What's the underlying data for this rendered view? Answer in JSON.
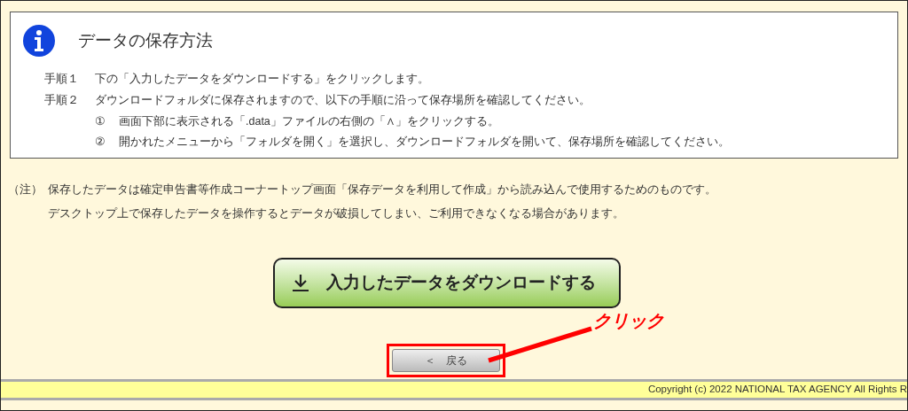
{
  "info_box": {
    "title": "データの保存方法",
    "steps": [
      {
        "label": "手順１",
        "text": "下の「入力したデータをダウンロードする」をクリックします。"
      },
      {
        "label": "手順２",
        "text": "ダウンロードフォルダに保存されますので、以下の手順に沿って保存場所を確認してください。",
        "substeps": [
          {
            "marker": "①",
            "text": "画面下部に表示される「.data」ファイルの右側の「∧」をクリックする。"
          },
          {
            "marker": "②",
            "text": "開かれたメニューから「フォルダを開く」を選択し、ダウンロードフォルダを開いて、保存場所を確認してください。"
          }
        ]
      }
    ]
  },
  "note": {
    "label": "（注）",
    "lines": [
      "保存したデータは確定申告書等作成コーナートップ画面「保存データを利用して作成」から読み込んで使用するためのものです。",
      "デスクトップ上で保存したデータを操作するとデータが破損してしまい、ご利用できなくなる場合があります。"
    ]
  },
  "download_button": {
    "label": "入力したデータをダウンロードする"
  },
  "back_button": {
    "label": "＜　戻る"
  },
  "annotation": {
    "label": "クリック"
  },
  "footer": {
    "copyright": "Copyright (c) 2022 NATIONAL TAX AGENCY All Rights R"
  }
}
